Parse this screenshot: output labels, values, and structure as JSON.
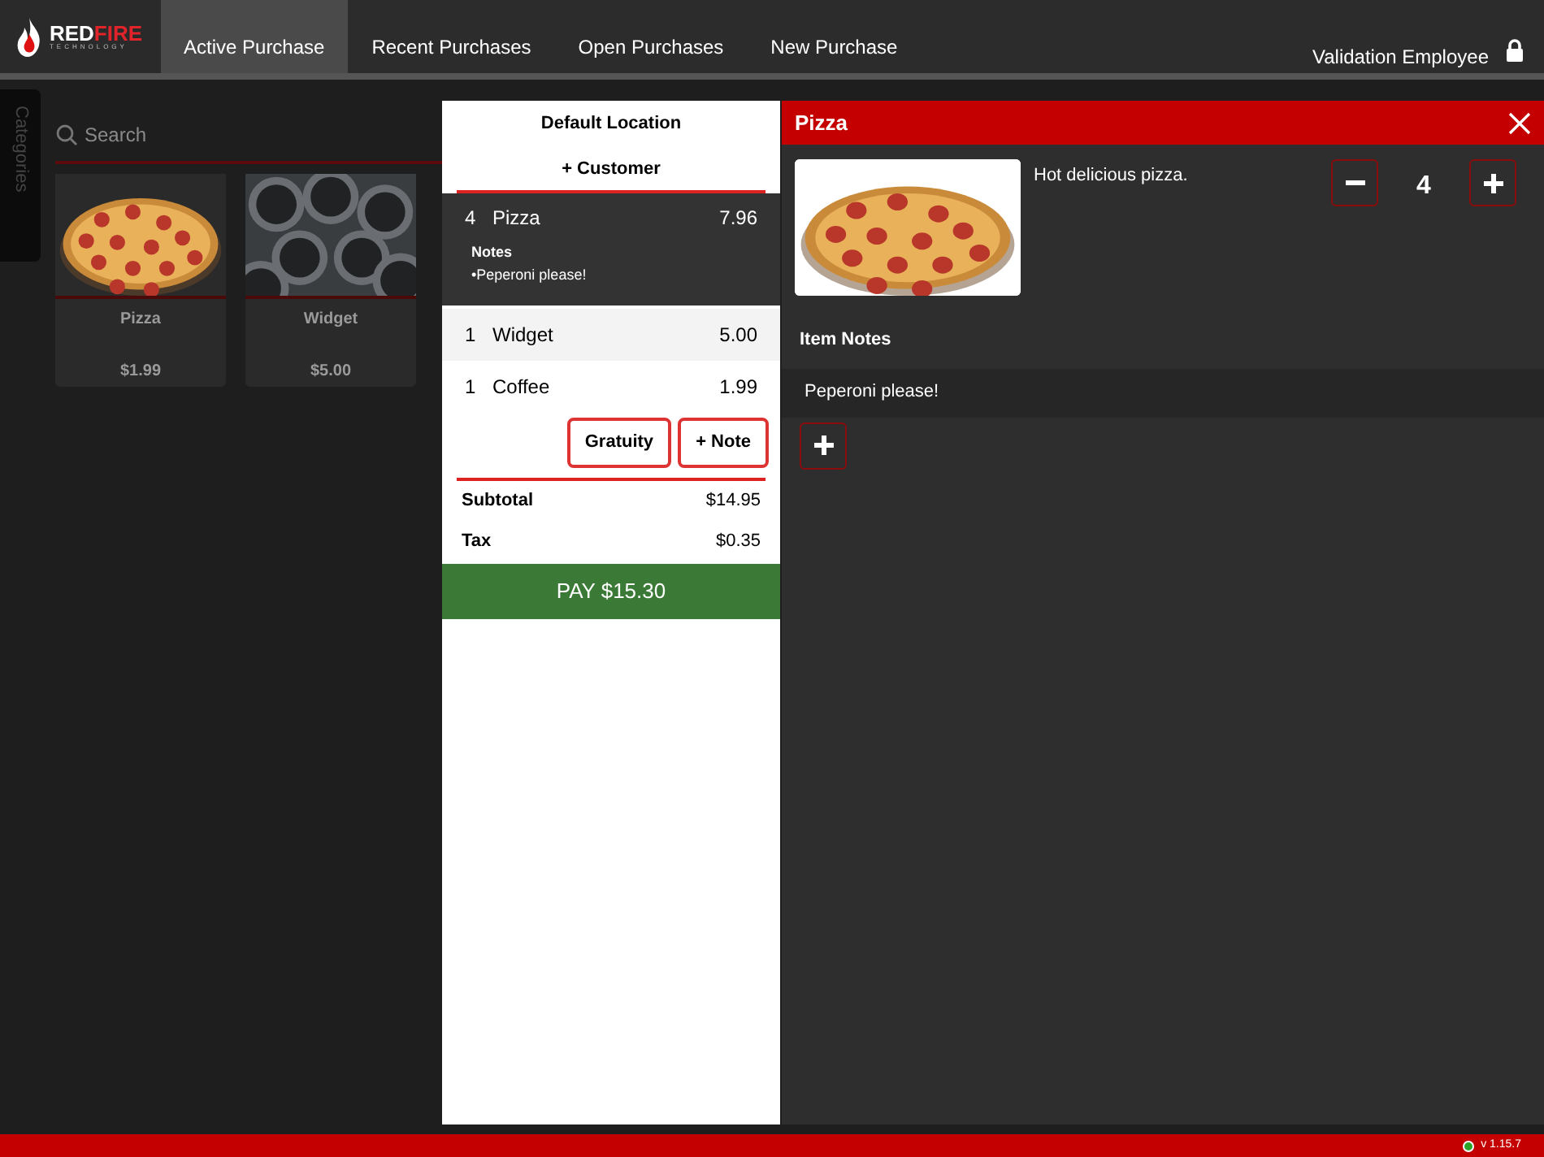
{
  "logo": {
    "red": "RED",
    "fire": "FIRE",
    "tagline": "TECHNOLOGY"
  },
  "tabs": [
    {
      "label": "Active Purchase",
      "selected": true
    },
    {
      "label": "Recent Purchases",
      "selected": false
    },
    {
      "label": "Open Purchases",
      "selected": false
    },
    {
      "label": "New Purchase",
      "selected": false
    }
  ],
  "user": {
    "name": "Validation Employee"
  },
  "categories_tab": "Categories",
  "search": {
    "placeholder": "Search"
  },
  "products": [
    {
      "name": "Pizza",
      "price": "$1.99",
      "kind": "pizza"
    },
    {
      "name": "Widget",
      "price": "$5.00",
      "kind": "pipes"
    }
  ],
  "cart": {
    "location": "Default Location",
    "customer": "+ Customer",
    "items": [
      {
        "qty": "4",
        "name": "Pizza",
        "price": "7.96",
        "selected": true,
        "notes_label": "Notes",
        "notes": [
          "•Peperoni please!"
        ]
      },
      {
        "qty": "1",
        "name": "Widget",
        "price": "5.00",
        "selected": false
      },
      {
        "qty": "1",
        "name": "Coffee",
        "price": "1.99",
        "selected": false
      }
    ],
    "buttons": [
      "Gratuity",
      "+ Note"
    ],
    "totals": [
      {
        "label": "Subtotal",
        "value": "$14.95"
      },
      {
        "label": "Tax",
        "value": "$0.35"
      }
    ],
    "pay": "PAY $15.30"
  },
  "item_panel": {
    "title": "Pizza",
    "description": "Hot delicious pizza.",
    "quantity": "4",
    "notes_heading": "Item Notes",
    "notes": [
      "Peperoni please!"
    ]
  },
  "status_bar": {
    "connected": true,
    "version": "v 1.15.7"
  }
}
